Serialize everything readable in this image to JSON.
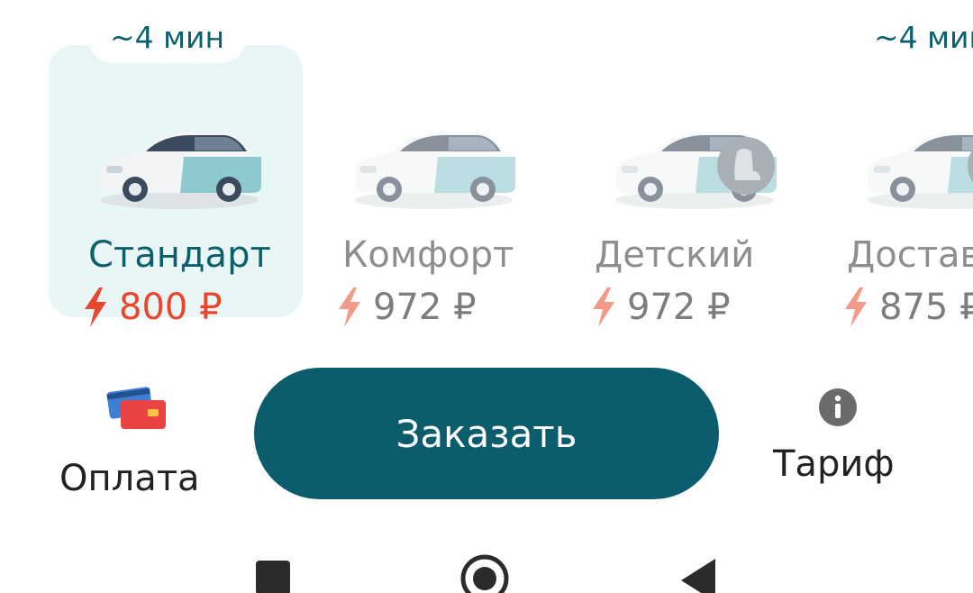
{
  "tariffs": [
    {
      "eta": "~4 мин",
      "name": "Стандарт",
      "price": "800 ₽",
      "selected": true,
      "car_icon": "sedan-car-icon"
    },
    {
      "eta": "",
      "name": "Комфорт",
      "price": "972 ₽",
      "selected": false,
      "car_icon": "comfort-car-icon"
    },
    {
      "eta": "",
      "name": "Детский",
      "price": "972 ₽",
      "selected": false,
      "car_icon": "child-seat-car-icon"
    },
    {
      "eta": "~4 мин",
      "name": "Достав",
      "price": "875 ₽",
      "selected": false,
      "car_icon": "delivery-car-icon"
    }
  ],
  "actions": {
    "payment_label": "Оплата",
    "order_label": "Заказать",
    "tariff_label": "Тариф"
  },
  "colors": {
    "accent": "#0b5d6d",
    "price_selected": "#e9462e",
    "selected_card_bg": "#e8f6f6"
  },
  "navbar": {
    "icons": [
      "recent-apps-icon",
      "home-icon",
      "back-icon"
    ]
  }
}
